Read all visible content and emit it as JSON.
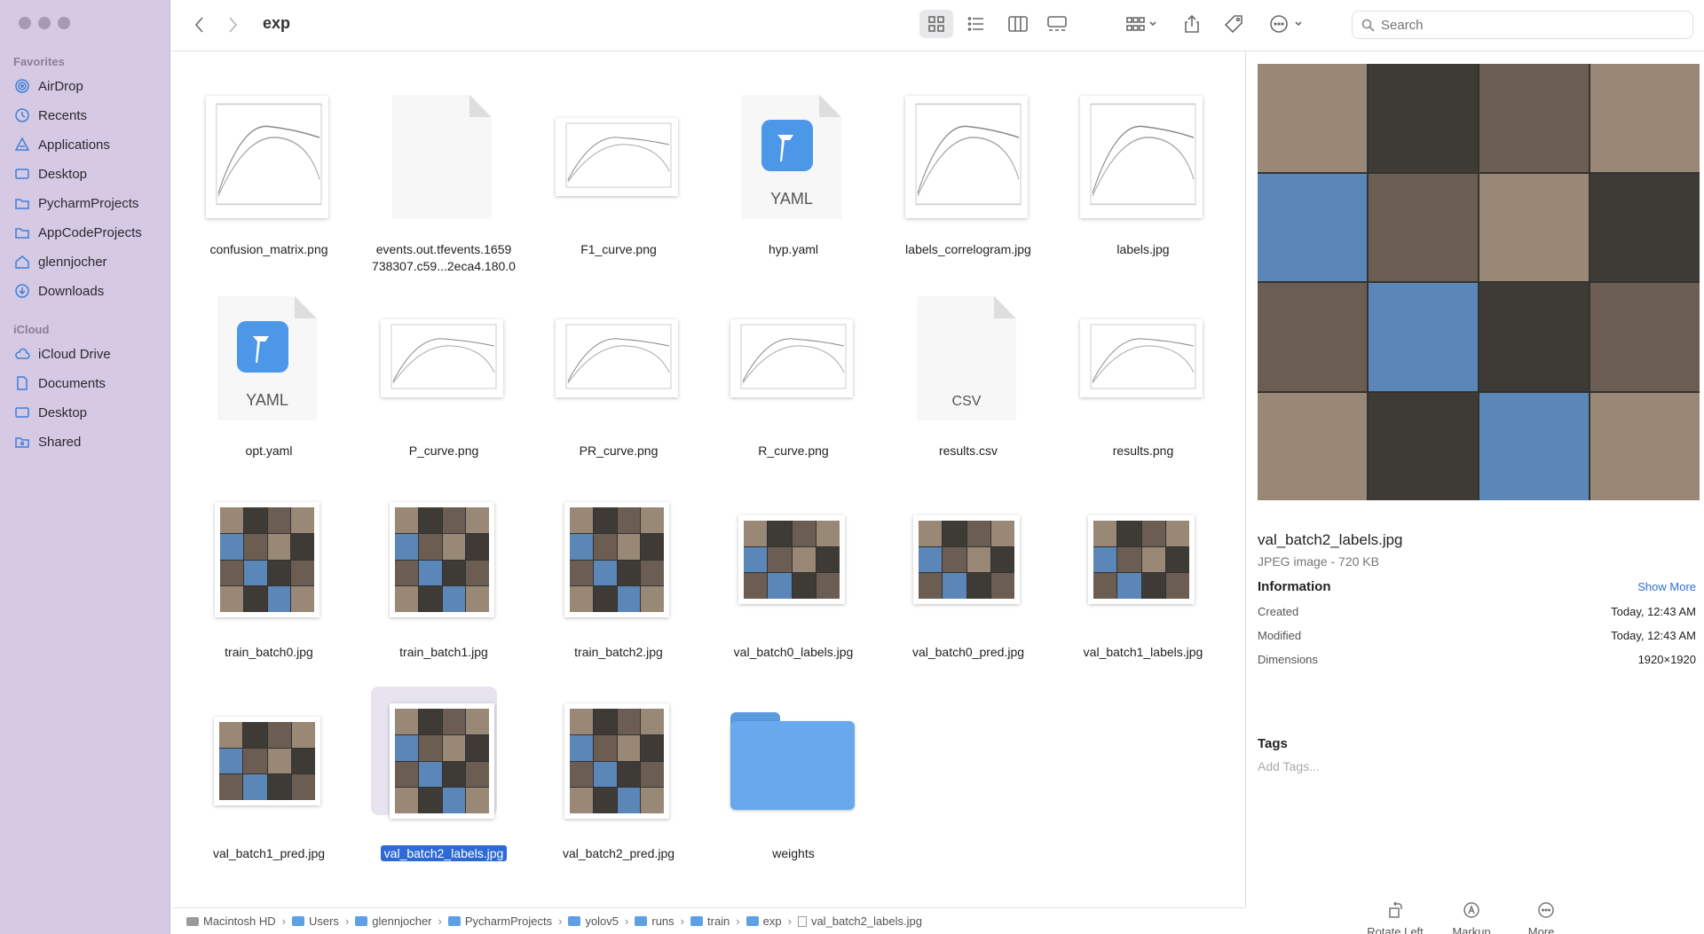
{
  "window": {
    "title": "exp"
  },
  "sidebar": {
    "favorites_label": "Favorites",
    "favorites": [
      {
        "label": "AirDrop",
        "icon": "airdrop-icon"
      },
      {
        "label": "Recents",
        "icon": "clock-icon"
      },
      {
        "label": "Applications",
        "icon": "applications-icon"
      },
      {
        "label": "Desktop",
        "icon": "desktop-icon"
      },
      {
        "label": "PycharmProjects",
        "icon": "folder-icon"
      },
      {
        "label": "AppCodeProjects",
        "icon": "folder-icon"
      },
      {
        "label": "glennjocher",
        "icon": "home-icon"
      },
      {
        "label": "Downloads",
        "icon": "download-icon"
      }
    ],
    "icloud_label": "iCloud",
    "icloud": [
      {
        "label": "iCloud Drive",
        "icon": "cloud-icon"
      },
      {
        "label": "Documents",
        "icon": "document-icon"
      },
      {
        "label": "Desktop",
        "icon": "desktop-icon"
      },
      {
        "label": "Shared",
        "icon": "shared-folder-icon"
      }
    ]
  },
  "toolbar": {
    "search_placeholder": "Search"
  },
  "files": [
    {
      "name": "confusion_matrix.png",
      "kind": "chart"
    },
    {
      "name": "events.out.tfevents.1659 738307.c59...2eca4.180.0",
      "kind": "doc"
    },
    {
      "name": "F1_curve.png",
      "kind": "chart"
    },
    {
      "name": "hyp.yaml",
      "kind": "yaml",
      "badge": "YAML"
    },
    {
      "name": "labels_correlogram.jpg",
      "kind": "chart"
    },
    {
      "name": "labels.jpg",
      "kind": "chart"
    },
    {
      "name": "opt.yaml",
      "kind": "yaml",
      "badge": "YAML"
    },
    {
      "name": "P_curve.png",
      "kind": "chart"
    },
    {
      "name": "PR_curve.png",
      "kind": "chart"
    },
    {
      "name": "R_curve.png",
      "kind": "chart"
    },
    {
      "name": "results.csv",
      "kind": "csv",
      "badge": "CSV"
    },
    {
      "name": "results.png",
      "kind": "chart"
    },
    {
      "name": "train_batch0.jpg",
      "kind": "mosaic"
    },
    {
      "name": "train_batch1.jpg",
      "kind": "mosaic"
    },
    {
      "name": "train_batch2.jpg",
      "kind": "mosaic"
    },
    {
      "name": "val_batch0_labels.jpg",
      "kind": "mosaic3"
    },
    {
      "name": "val_batch0_pred.jpg",
      "kind": "mosaic3"
    },
    {
      "name": "val_batch1_labels.jpg",
      "kind": "mosaic3"
    },
    {
      "name": "val_batch1_pred.jpg",
      "kind": "mosaic3"
    },
    {
      "name": "val_batch2_labels.jpg",
      "kind": "mosaic",
      "selected": true
    },
    {
      "name": "val_batch2_pred.jpg",
      "kind": "mosaic"
    },
    {
      "name": "weights",
      "kind": "folder"
    }
  ],
  "preview": {
    "name": "val_batch2_labels.jpg",
    "kind": "JPEG image - 720 KB",
    "information_label": "Information",
    "show_more": "Show More",
    "rows": [
      {
        "key": "Created",
        "value": "Today, 12:43 AM"
      },
      {
        "key": "Modified",
        "value": "Today, 12:43 AM"
      },
      {
        "key": "Dimensions",
        "value": "1920×1920"
      }
    ],
    "tags_label": "Tags",
    "add_tags": "Add Tags...",
    "actions": [
      {
        "label": "Rotate Left",
        "icon": "rotate-left-icon"
      },
      {
        "label": "Markup",
        "icon": "markup-icon"
      },
      {
        "label": "More...",
        "icon": "more-icon"
      }
    ]
  },
  "pathbar": [
    {
      "label": "Macintosh HD",
      "icon": "hd"
    },
    {
      "label": "Users",
      "icon": "folder"
    },
    {
      "label": "glennjocher",
      "icon": "folder"
    },
    {
      "label": "PycharmProjects",
      "icon": "folder"
    },
    {
      "label": "yolov5",
      "icon": "folder"
    },
    {
      "label": "runs",
      "icon": "folder"
    },
    {
      "label": "train",
      "icon": "folder"
    },
    {
      "label": "exp",
      "icon": "folder"
    },
    {
      "label": "val_batch2_labels.jpg",
      "icon": "jpg"
    }
  ]
}
